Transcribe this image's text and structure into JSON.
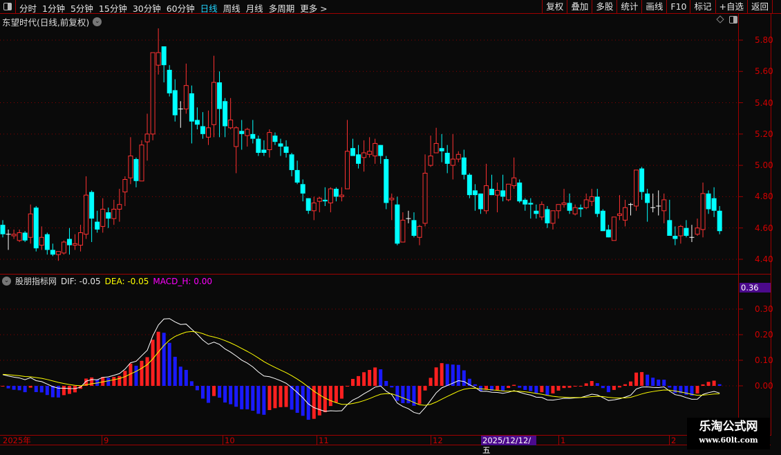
{
  "topbar": {
    "tabs": [
      "分时",
      "1分钟",
      "5分钟",
      "15分钟",
      "30分钟",
      "60分钟",
      "日线",
      "周线",
      "月线",
      "多周期",
      "更多 >"
    ],
    "active_tab": "日线",
    "buttons": [
      "复权",
      "叠加",
      "多股",
      "统计",
      "画线",
      "F10",
      "标记",
      "+自选",
      "返回"
    ]
  },
  "main": {
    "title": "东望时代(日线,前复权)",
    "price_ticks": [
      "5.80",
      "5.60",
      "5.40",
      "5.20",
      "5.00",
      "4.80",
      "4.60",
      "4.40"
    ]
  },
  "macd": {
    "name": "股朋指标网",
    "dif": "DIF: -0.05",
    "dea": "DEA: -0.05",
    "macd_h": "MACD_H: 0.00",
    "current": "0.36",
    "ticks": [
      "0.30",
      "0.20",
      "0.10",
      "0.00"
    ]
  },
  "time_axis": {
    "labels": [
      "2025年",
      "9",
      "10",
      "11",
      "12",
      "1",
      "2"
    ],
    "cursor": "2025/12/12/五"
  },
  "watermark": {
    "name": "乐淘公式网",
    "url": "www.60lt.com"
  },
  "colors": {
    "up": "#ff3232",
    "down": "#00ffff",
    "flat": "#ffffff",
    "dif": "#ffffff",
    "dea": "#ffff00",
    "hist_up": "#ff2020",
    "hist_down": "#1a1aff",
    "grid": "#8b0000"
  },
  "chart_data": {
    "type": "candlestick",
    "price_range": [
      4.4,
      5.8
    ],
    "macd_range": [
      -0.2,
      0.36
    ],
    "macd_params": [
      12,
      26,
      9
    ],
    "candles": [
      [
        4.62,
        4.65,
        4.54,
        4.56
      ],
      [
        4.56,
        4.59,
        4.46,
        4.56
      ],
      [
        4.55,
        4.59,
        4.53,
        4.56
      ],
      [
        4.52,
        4.59,
        4.51,
        4.57
      ],
      [
        4.57,
        4.58,
        4.51,
        4.52
      ],
      [
        4.54,
        4.75,
        4.5,
        4.69
      ],
      [
        4.73,
        4.74,
        4.45,
        4.47
      ],
      [
        4.49,
        4.61,
        4.46,
        4.54
      ],
      [
        4.56,
        4.57,
        4.43,
        4.46
      ],
      [
        4.46,
        4.5,
        4.42,
        4.43
      ],
      [
        4.43,
        4.45,
        4.39,
        4.45
      ],
      [
        4.44,
        4.52,
        4.43,
        4.51
      ],
      [
        4.53,
        4.6,
        4.43,
        4.49
      ],
      [
        4.49,
        4.56,
        4.46,
        4.5
      ],
      [
        4.49,
        4.62,
        4.45,
        4.57
      ],
      [
        4.56,
        4.93,
        4.53,
        4.81
      ],
      [
        4.83,
        4.84,
        4.51,
        4.66
      ],
      [
        4.64,
        4.71,
        4.57,
        4.59
      ],
      [
        4.61,
        4.79,
        4.57,
        4.72
      ],
      [
        4.7,
        4.73,
        4.6,
        4.66
      ],
      [
        4.66,
        4.78,
        4.62,
        4.72
      ],
      [
        4.72,
        4.85,
        4.64,
        4.75
      ],
      [
        4.83,
        4.93,
        4.74,
        4.91
      ],
      [
        4.92,
        5.18,
        4.88,
        5.06
      ],
      [
        5.04,
        5.05,
        4.86,
        4.9
      ],
      [
        4.9,
        5.16,
        4.9,
        5.13
      ],
      [
        5.15,
        5.33,
        5.03,
        5.2
      ],
      [
        5.2,
        5.72,
        5.16,
        5.72
      ],
      [
        5.64,
        5.875,
        5.58,
        5.72
      ],
      [
        5.76,
        5.76,
        5.53,
        5.64
      ],
      [
        5.61,
        5.64,
        5.44,
        5.46
      ],
      [
        5.48,
        5.55,
        5.28,
        5.32
      ],
      [
        5.36,
        5.41,
        5.24,
        5.36
      ],
      [
        5.36,
        5.65,
        5.33,
        5.51
      ],
      [
        5.46,
        5.51,
        5.14,
        5.28
      ],
      [
        5.29,
        5.37,
        5.23,
        5.26
      ],
      [
        5.25,
        5.34,
        5.17,
        5.2
      ],
      [
        5.18,
        5.35,
        5.13,
        5.24
      ],
      [
        5.26,
        5.7,
        5.18,
        5.53
      ],
      [
        5.53,
        5.6,
        5.18,
        5.36
      ],
      [
        5.41,
        5.43,
        5.18,
        5.25
      ],
      [
        5.24,
        5.43,
        5.23,
        5.29
      ],
      [
        5.12,
        5.25,
        4.95,
        5.24
      ],
      [
        5.22,
        5.29,
        5.1,
        5.2
      ],
      [
        5.19,
        5.24,
        5.12,
        5.23
      ],
      [
        5.2,
        5.29,
        5.14,
        5.17
      ],
      [
        5.17,
        5.19,
        5.06,
        5.08
      ],
      [
        5.1,
        5.16,
        5.06,
        5.08
      ],
      [
        5.1,
        5.23,
        5.05,
        5.21
      ],
      [
        5.19,
        5.21,
        5.13,
        5.15
      ],
      [
        5.14,
        5.17,
        5.06,
        5.12
      ],
      [
        5.12,
        5.16,
        5.05,
        5.08
      ],
      [
        5.07,
        5.08,
        4.93,
        4.97
      ],
      [
        4.97,
        5.03,
        4.88,
        4.89
      ],
      [
        4.88,
        4.91,
        4.77,
        4.82
      ],
      [
        4.79,
        4.79,
        4.69,
        4.71
      ],
      [
        4.71,
        4.8,
        4.65,
        4.76
      ],
      [
        4.77,
        4.8,
        4.7,
        4.79
      ],
      [
        4.78,
        4.86,
        4.74,
        4.77
      ],
      [
        4.76,
        4.86,
        4.7,
        4.85
      ],
      [
        4.85,
        4.86,
        4.77,
        4.8
      ],
      [
        4.8,
        4.86,
        4.77,
        4.81
      ],
      [
        4.85,
        5.29,
        4.85,
        5.09
      ],
      [
        5.11,
        5.17,
        5.06,
        5.06
      ],
      [
        5.07,
        5.13,
        4.98,
        5.01
      ],
      [
        5.05,
        5.16,
        4.96,
        5.08
      ],
      [
        5.07,
        5.18,
        5.05,
        5.09
      ],
      [
        5.06,
        5.17,
        5.01,
        5.14
      ],
      [
        5.13,
        5.13,
        5.01,
        5.06
      ],
      [
        5.04,
        5.06,
        4.72,
        4.76
      ],
      [
        4.78,
        4.82,
        4.65,
        4.79
      ],
      [
        4.75,
        4.8,
        4.49,
        4.5
      ],
      [
        4.51,
        4.7,
        4.51,
        4.65
      ],
      [
        4.66,
        4.71,
        4.63,
        4.66
      ],
      [
        4.65,
        4.7,
        4.54,
        4.55
      ],
      [
        4.54,
        4.62,
        4.49,
        4.61
      ],
      [
        4.63,
        5.07,
        4.61,
        4.95
      ],
      [
        5.0,
        5.19,
        4.99,
        5.06
      ],
      [
        5.08,
        5.24,
        5.08,
        5.14
      ],
      [
        5.11,
        5.2,
        5.02,
        5.09
      ],
      [
        5.08,
        5.13,
        4.95,
        5.01
      ],
      [
        5.0,
        5.2,
        4.91,
        5.04
      ],
      [
        5.04,
        5.09,
        5.02,
        5.07
      ],
      [
        5.05,
        5.1,
        4.91,
        4.94
      ],
      [
        4.94,
        4.95,
        4.79,
        4.81
      ],
      [
        4.84,
        4.88,
        4.71,
        4.81
      ],
      [
        4.82,
        4.82,
        4.69,
        4.72
      ],
      [
        4.71,
        5.01,
        4.69,
        4.87
      ],
      [
        4.85,
        4.94,
        4.81,
        4.81
      ],
      [
        4.81,
        4.89,
        4.7,
        4.84
      ],
      [
        4.84,
        4.94,
        4.77,
        4.8
      ],
      [
        4.78,
        4.88,
        4.77,
        4.88
      ],
      [
        4.87,
        5.05,
        4.85,
        4.92
      ],
      [
        4.89,
        4.91,
        4.76,
        4.77
      ],
      [
        4.78,
        4.79,
        4.71,
        4.75
      ],
      [
        4.76,
        4.79,
        4.66,
        4.75
      ],
      [
        4.71,
        4.75,
        4.66,
        4.69
      ],
      [
        4.67,
        4.77,
        4.65,
        4.75
      ],
      [
        4.72,
        4.74,
        4.6,
        4.63
      ],
      [
        4.63,
        4.71,
        4.59,
        4.71
      ],
      [
        4.71,
        4.75,
        4.66,
        4.75
      ],
      [
        4.75,
        4.85,
        4.73,
        4.76
      ],
      [
        4.76,
        4.82,
        4.69,
        4.71
      ],
      [
        4.69,
        4.75,
        4.68,
        4.73
      ],
      [
        4.73,
        4.75,
        4.67,
        4.72
      ],
      [
        4.73,
        4.82,
        4.72,
        4.78
      ],
      [
        4.77,
        4.85,
        4.74,
        4.8
      ],
      [
        4.8,
        4.85,
        4.67,
        4.69
      ],
      [
        4.71,
        4.72,
        4.58,
        4.58
      ],
      [
        4.59,
        4.62,
        4.54,
        4.54
      ],
      [
        4.52,
        4.67,
        4.52,
        4.67
      ],
      [
        4.68,
        4.81,
        4.65,
        4.69
      ],
      [
        4.65,
        4.78,
        4.61,
        4.73
      ],
      [
        4.75,
        4.76,
        4.68,
        4.75
      ],
      [
        4.74,
        4.97,
        4.71,
        4.97
      ],
      [
        4.98,
        4.99,
        4.78,
        4.83
      ],
      [
        4.82,
        4.85,
        4.64,
        4.76
      ],
      [
        4.73,
        4.82,
        4.7,
        4.73
      ],
      [
        4.74,
        4.84,
        4.68,
        4.74
      ],
      [
        4.71,
        4.82,
        4.63,
        4.78
      ],
      [
        4.65,
        4.78,
        4.55,
        4.55
      ],
      [
        4.55,
        4.61,
        4.49,
        4.53
      ],
      [
        4.55,
        4.62,
        4.5,
        4.61
      ],
      [
        4.6,
        4.65,
        4.54,
        4.55
      ],
      [
        4.54,
        4.62,
        4.51,
        4.54
      ],
      [
        4.56,
        4.66,
        4.55,
        4.6
      ],
      [
        4.59,
        4.89,
        4.54,
        4.82
      ],
      [
        4.82,
        4.84,
        4.69,
        4.72
      ],
      [
        4.79,
        4.86,
        4.67,
        4.71
      ],
      [
        4.71,
        4.74,
        4.56,
        4.58
      ]
    ]
  }
}
